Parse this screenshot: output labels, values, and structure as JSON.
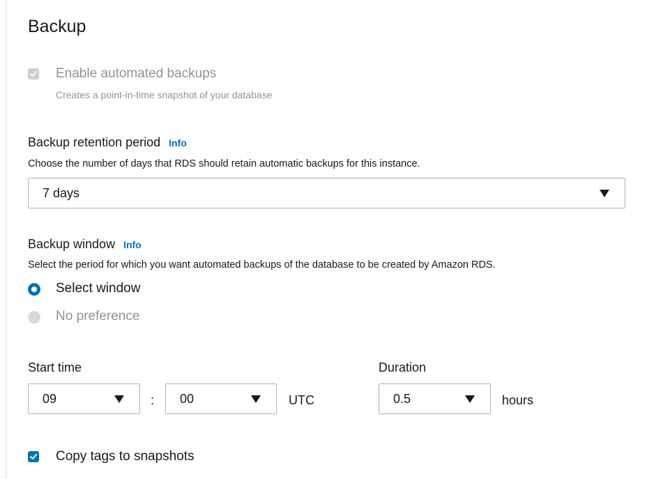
{
  "section": {
    "title": "Backup"
  },
  "automated_backups": {
    "label": "Enable automated backups",
    "description": "Creates a point-in-time snapshot of your database",
    "checked": true,
    "disabled": true
  },
  "retention": {
    "label": "Backup retention period",
    "info": "Info",
    "description": "Choose the number of days that RDS should retain automatic backups for this instance.",
    "selected": "7 days"
  },
  "window": {
    "label": "Backup window",
    "info": "Info",
    "description": "Select the period for which you want automated backups of the database to be created by Amazon RDS.",
    "options": [
      {
        "label": "Select window",
        "selected": true,
        "disabled": false
      },
      {
        "label": "No preference",
        "selected": false,
        "disabled": true
      }
    ]
  },
  "start_time": {
    "label": "Start time",
    "hour": "09",
    "separator": ":",
    "minute": "00",
    "timezone": "UTC"
  },
  "duration": {
    "label": "Duration",
    "value": "0.5",
    "unit": "hours"
  },
  "copy_tags": {
    "label": "Copy tags to snapshots",
    "checked": true
  },
  "colors": {
    "accent": "#0073bb",
    "disabled": "#8d9498",
    "text": "#16191f"
  }
}
